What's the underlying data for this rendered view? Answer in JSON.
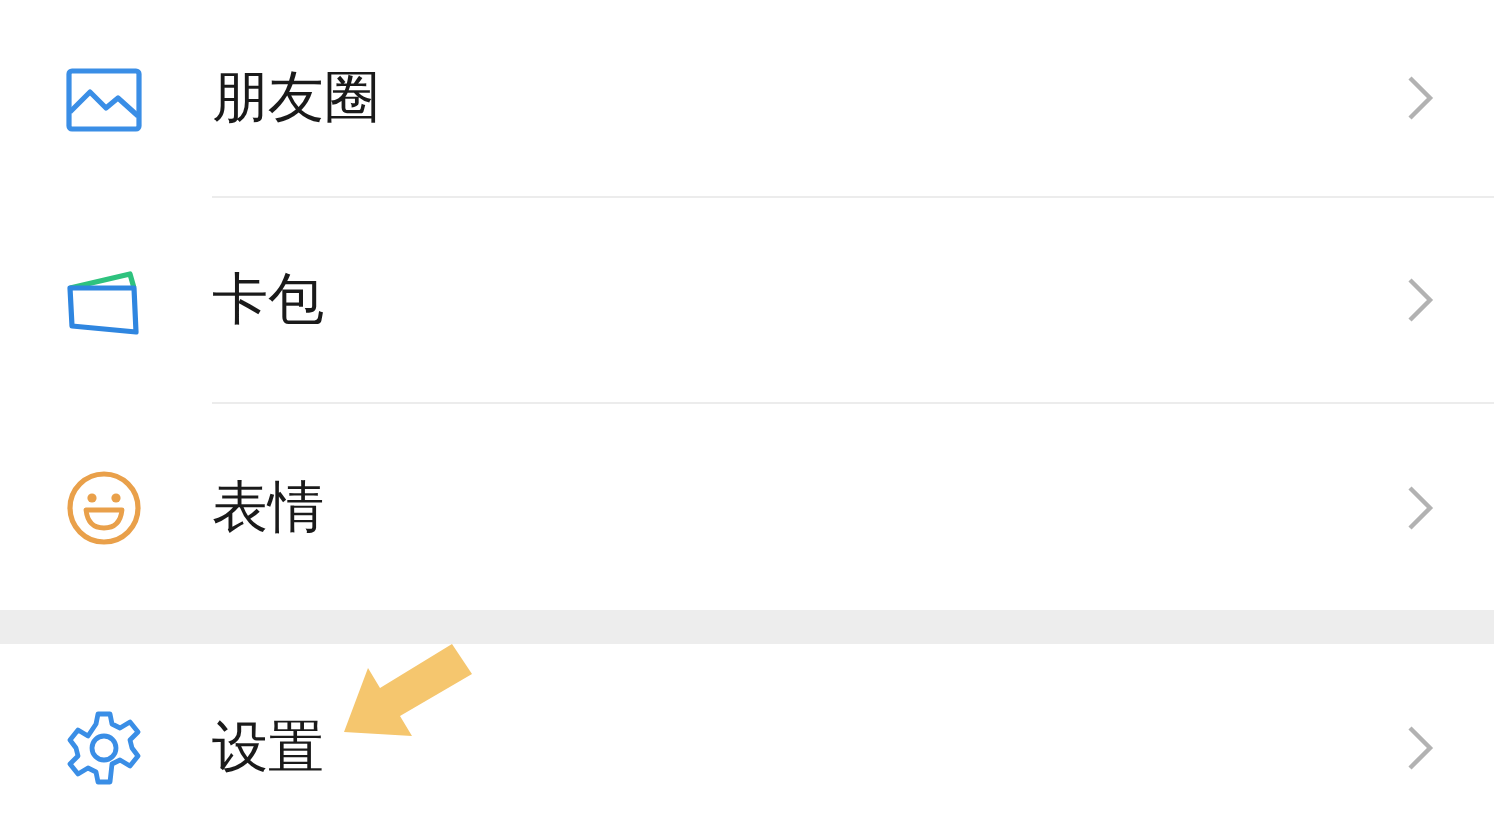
{
  "sections": [
    {
      "items": [
        {
          "label": "朋友圈"
        },
        {
          "label": "卡包"
        },
        {
          "label": "表情"
        }
      ]
    },
    {
      "items": [
        {
          "label": "设置"
        }
      ]
    }
  ]
}
